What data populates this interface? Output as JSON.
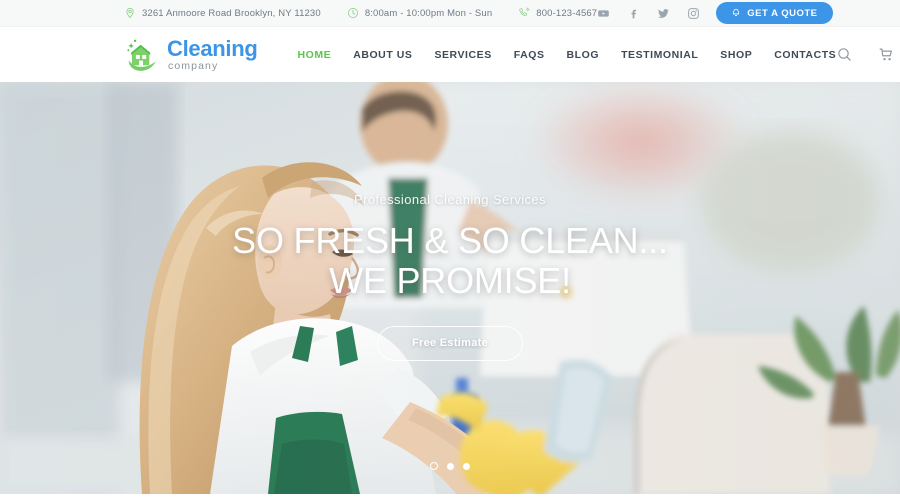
{
  "topbar": {
    "address": {
      "icon": "map-pin-icon",
      "text": "3261 Anmoore Road Brooklyn, NY 11230"
    },
    "hours": {
      "icon": "clock-icon",
      "text": "8:00am - 10:00pm Mon - Sun"
    },
    "phone": {
      "icon": "phone-icon",
      "text": "800-123-4567"
    },
    "social": [
      {
        "name": "youtube-icon",
        "label": "YouTube"
      },
      {
        "name": "facebook-icon",
        "label": "Facebook"
      },
      {
        "name": "twitter-icon",
        "label": "Twitter"
      },
      {
        "name": "instagram-icon",
        "label": "Instagram"
      }
    ],
    "quote_button": {
      "label": "GET A QUOTE",
      "icon": "bell-icon",
      "color": "#3d95e8"
    }
  },
  "header": {
    "logo": {
      "main": "Cleaning",
      "sub": "company",
      "icon": "house-sparkle-icon",
      "main_color": "#3d95e8",
      "sub_color": "#8b949c",
      "mark_color": "#5cc64c"
    },
    "nav": [
      {
        "label": "HOME",
        "active": true
      },
      {
        "label": "ABOUT US",
        "active": false
      },
      {
        "label": "SERVICES",
        "active": false
      },
      {
        "label": "FAQS",
        "active": false
      },
      {
        "label": "BLOG",
        "active": false
      },
      {
        "label": "TESTIMONIAL",
        "active": false
      },
      {
        "label": "SHOP",
        "active": false
      },
      {
        "label": "CONTACTS",
        "active": false
      }
    ],
    "nav_active_color": "#5cc64c",
    "nav_color": "#3f4a56",
    "icons": [
      {
        "name": "search-icon"
      },
      {
        "name": "cart-icon"
      }
    ]
  },
  "hero": {
    "subtitle": "Professional Cleaning Services",
    "title_line1": "SO FRESH & SO CLEAN...",
    "title_line2": "WE PROMISE!",
    "cta_label": "Free Estimate",
    "slides": [
      {
        "active": true
      },
      {
        "active": false
      },
      {
        "active": false
      }
    ]
  }
}
